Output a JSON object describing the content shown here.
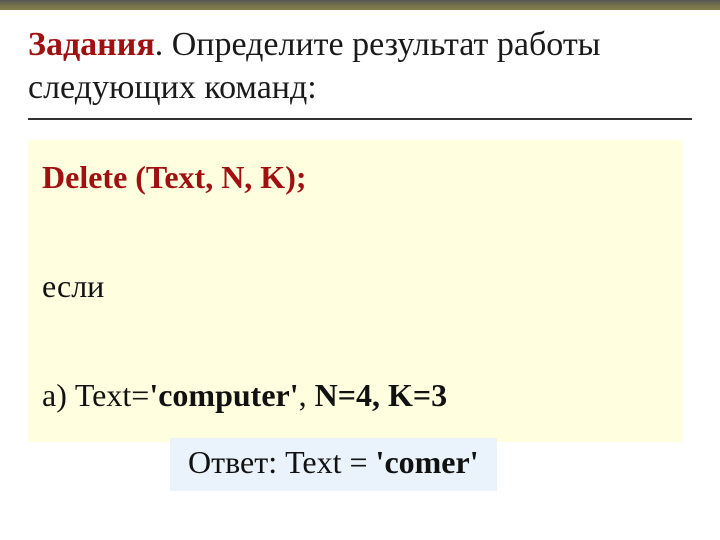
{
  "title": {
    "label": "Задания",
    "dot": ". ",
    "rest": "Определите результат работы следующих команд:"
  },
  "code": {
    "deleteCall": "Delete (Text, N, K);",
    "ifWord": "если",
    "caseLabel": "а) Text=",
    "textValue": "'computer'",
    "separator": ",  ",
    "nAssign": "N=4, K=3"
  },
  "answer": {
    "prefix": "Ответ: Text = ",
    "value": "'comer'"
  }
}
